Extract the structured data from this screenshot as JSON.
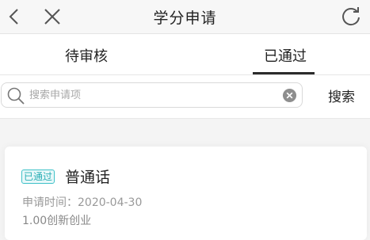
{
  "header": {
    "title": "学分申请"
  },
  "tabs": [
    {
      "label": "待审核",
      "active": false
    },
    {
      "label": "已通过",
      "active": true
    }
  ],
  "search": {
    "placeholder": "搜索申请项",
    "value": "",
    "button_label": "搜索"
  },
  "records": [
    {
      "status": "已通过",
      "title": "普通话",
      "time_label": "申请时间：",
      "time_value": "2020-04-30",
      "credit": "1.00创新创业"
    }
  ],
  "colors": {
    "status_approved": "#2aaeb5",
    "tab_underline": "#2b2b2b"
  }
}
